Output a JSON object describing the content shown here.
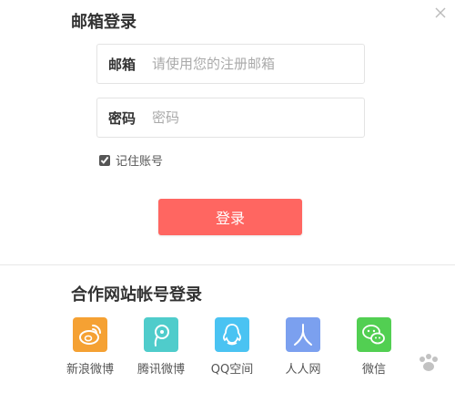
{
  "dialog": {
    "title": "邮箱登录",
    "email": {
      "label": "邮箱",
      "value": "",
      "placeholder": "请使用您的注册邮箱"
    },
    "password": {
      "label": "密码",
      "value": "",
      "placeholder": "密码"
    },
    "remember": {
      "label": "记住账号",
      "checked": true
    },
    "login_label": "登录",
    "partner_title": "合作网站帐号登录",
    "partners": [
      {
        "name": "新浪微博",
        "icon": "sina-weibo-icon",
        "color": "#f5a133"
      },
      {
        "name": "腾讯微博",
        "icon": "tencent-weibo-icon",
        "color": "#4fcccb"
      },
      {
        "name": "QQ空间",
        "icon": "qq-icon",
        "color": "#4ac3f2"
      },
      {
        "name": "人人网",
        "icon": "renren-icon",
        "color": "#7ba0ef"
      },
      {
        "name": "微信",
        "icon": "wechat-icon",
        "color": "#52cf52"
      }
    ]
  },
  "colors": {
    "login_button": "#ff6661",
    "border": "#e3e3e3"
  }
}
